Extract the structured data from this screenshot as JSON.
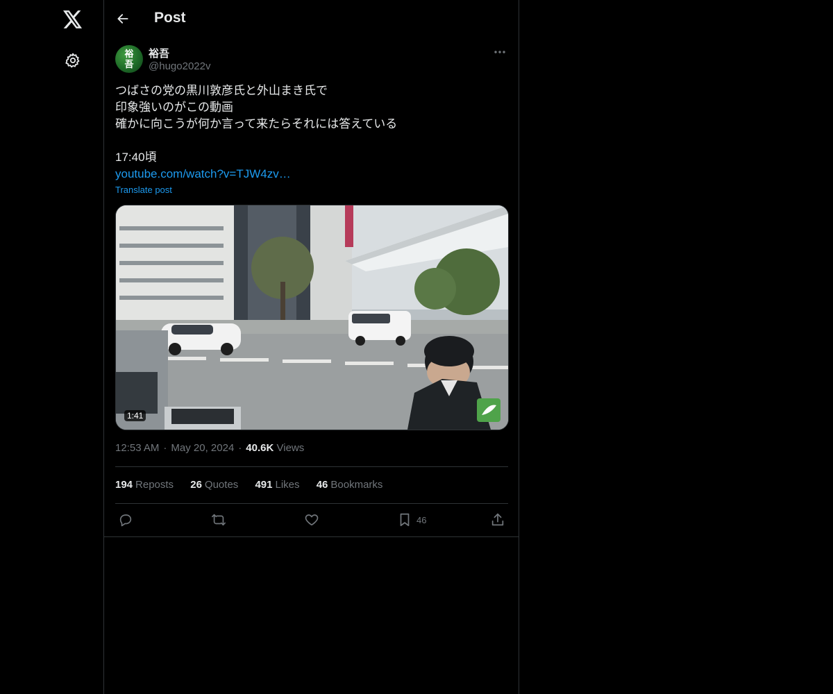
{
  "header": {
    "title": "Post"
  },
  "author": {
    "avatar_text_top": "裕",
    "avatar_text_bottom": "吾",
    "name": "裕吾",
    "handle": "@hugo2022v"
  },
  "tweet": {
    "lines": [
      "つばさの党の黒川敦彦氏と外山まき氏で",
      "印象強いのがこの動画",
      "確かに向こうが何か言って来たらそれには答えている",
      "",
      "17:40頃"
    ],
    "link_text": "youtube.com/watch?v=TJW4zv…",
    "translate_label": "Translate post"
  },
  "media": {
    "duration": "1:41"
  },
  "meta": {
    "time": "12:53 AM",
    "date": "May 20, 2024",
    "views_count": "40.6K",
    "views_label": "Views"
  },
  "stats": {
    "reposts_count": "194",
    "reposts_label": "Reposts",
    "quotes_count": "26",
    "quotes_label": "Quotes",
    "likes_count": "491",
    "likes_label": "Likes",
    "bookmarks_count": "46",
    "bookmarks_label": "Bookmarks"
  },
  "actions": {
    "bookmark_count": "46"
  },
  "icons": {
    "logo": "x-logo-icon",
    "settings": "gear-icon",
    "back": "arrow-left-icon",
    "more": "more-horizontal-icon",
    "reply": "reply-icon",
    "repost": "repost-icon",
    "like": "heart-icon",
    "bookmark": "bookmark-icon",
    "share": "share-icon"
  },
  "colors": {
    "background": "#000000",
    "text_primary": "#e7e9ea",
    "text_secondary": "#71767b",
    "link": "#1d9bf0",
    "border": "#2f3336"
  }
}
